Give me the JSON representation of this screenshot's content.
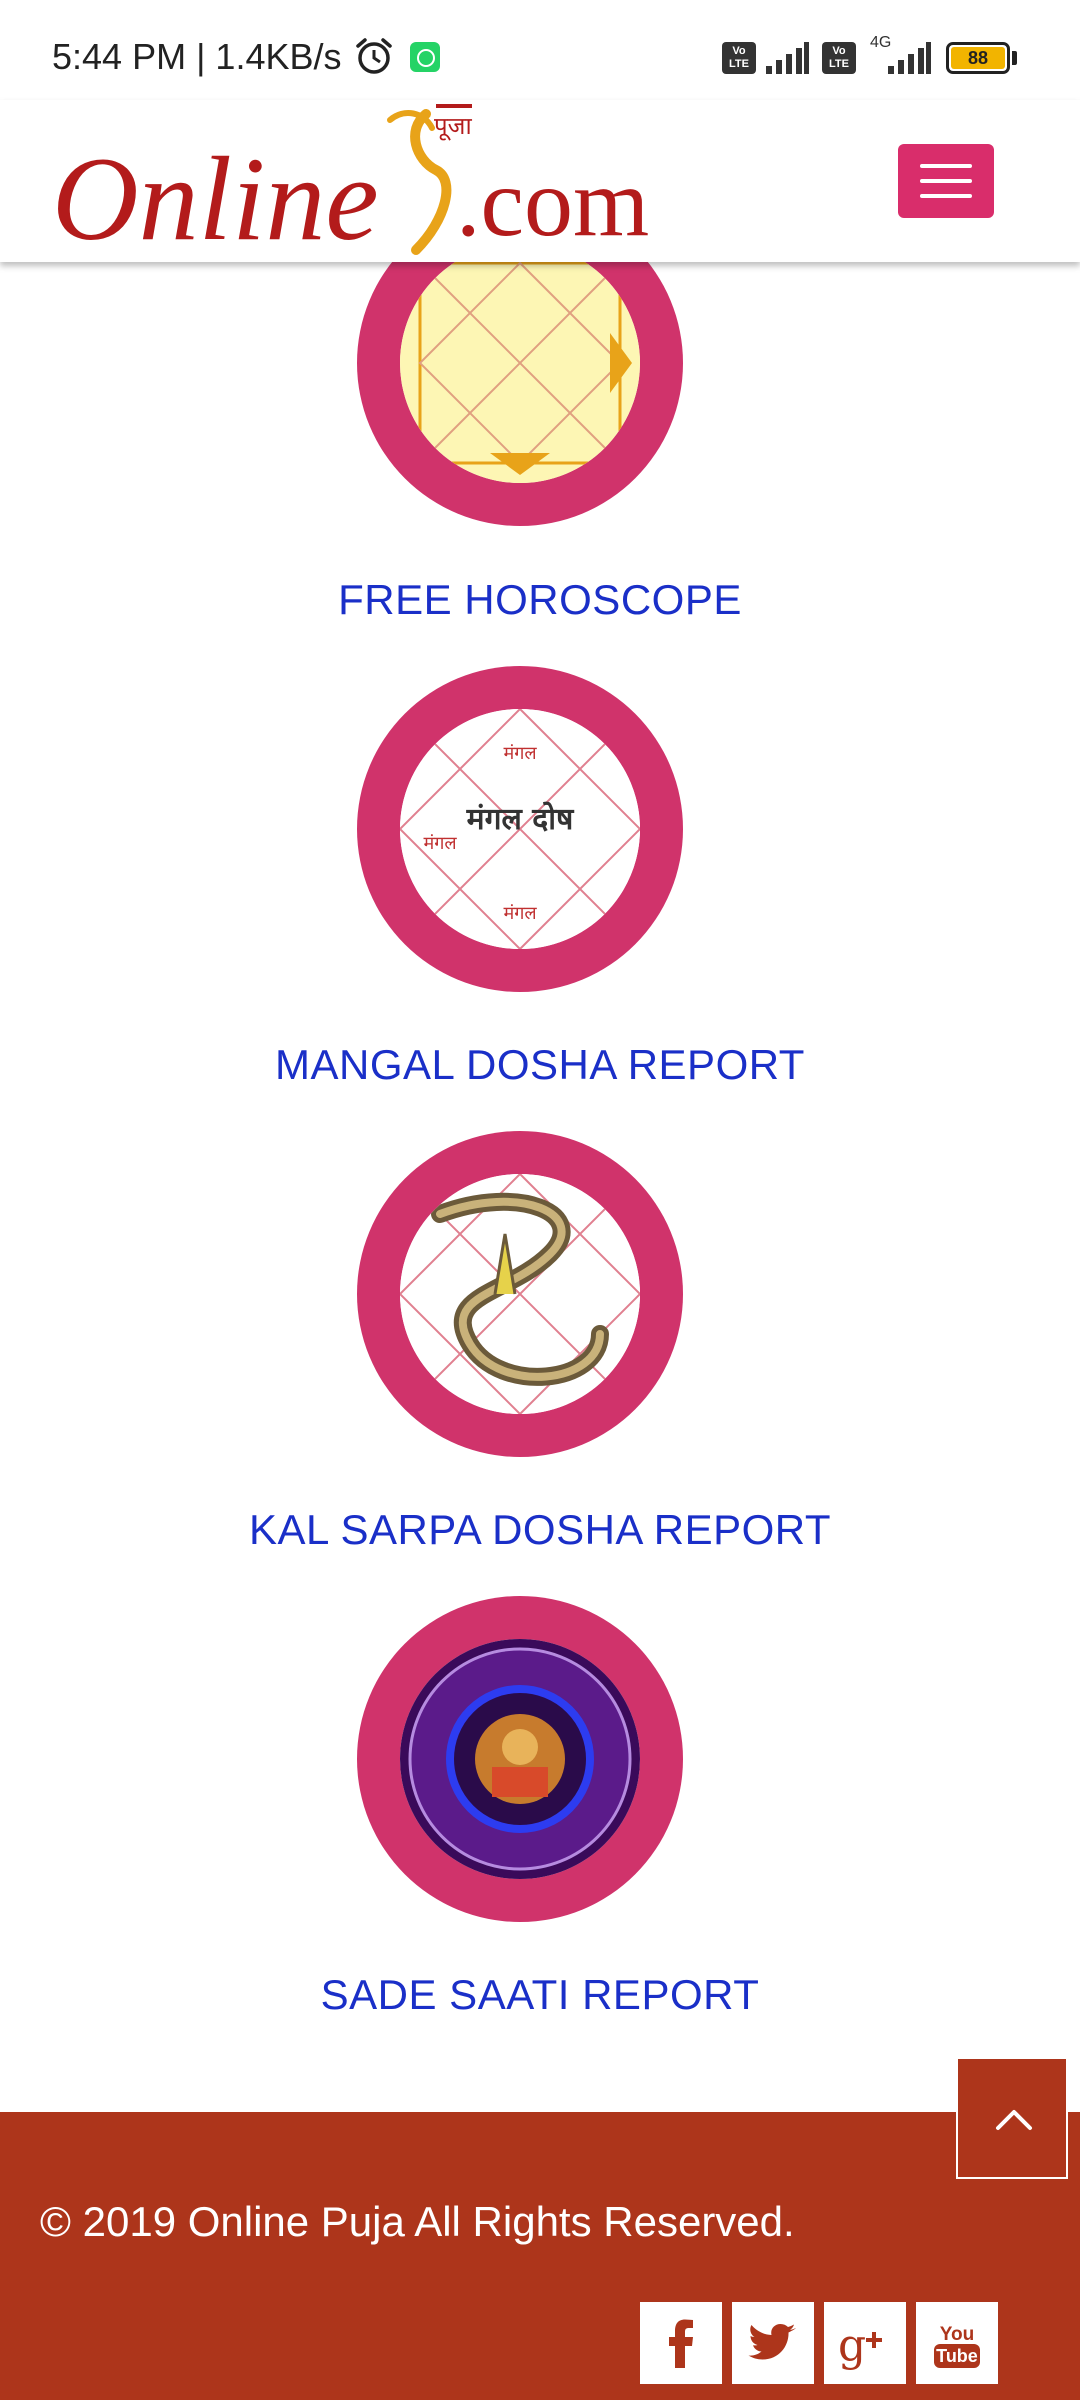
{
  "status_bar": {
    "time_speed": "5:44 PM | 1.4KB/s",
    "volte_label": "Vo LTE",
    "network_type": "4G",
    "battery_level": "88"
  },
  "header": {
    "logo_text_left": "Online",
    "logo_text_right": ".com",
    "logo_devanagari": "पूजा"
  },
  "services": [
    {
      "label": "FREE HOROSCOPE"
    },
    {
      "label": "MANGAL DOSHA REPORT",
      "image_text": "मंगल दोष",
      "chart_text": "मंगल"
    },
    {
      "label": "KAL SARPA DOSHA REPORT"
    },
    {
      "label": "SADE SAATI REPORT"
    }
  ],
  "footer": {
    "copyright": "© 2019 Online Puja All Rights Reserved.",
    "social": [
      "facebook",
      "twitter",
      "google-plus",
      "youtube"
    ]
  },
  "colors": {
    "accent_pink": "#d0336b",
    "menu_pink": "#d92d6b",
    "link_blue": "#1a2fc8",
    "footer_brown": "#ad351b",
    "logo_red": "#b31b1b"
  }
}
